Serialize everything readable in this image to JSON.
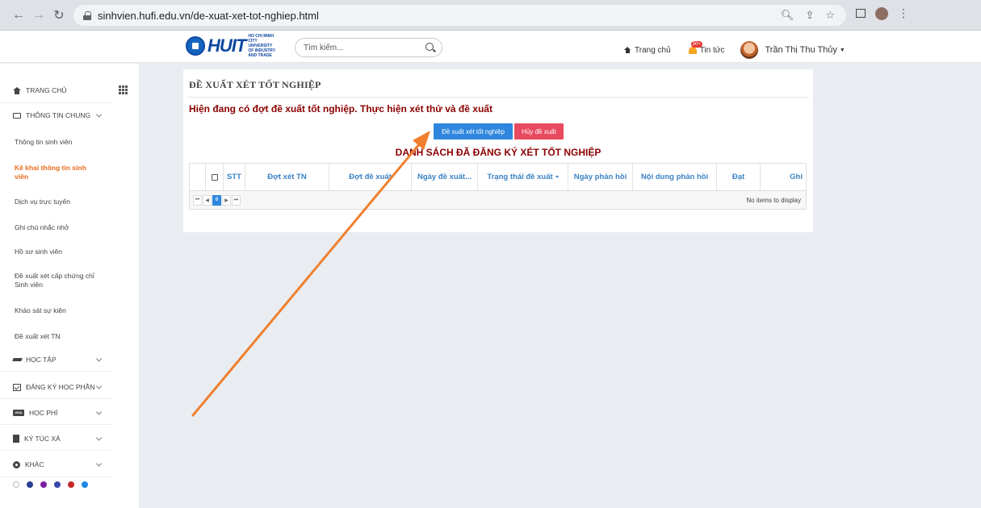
{
  "browser": {
    "url": "sinhvien.hufi.edu.vn/de-xuat-xet-tot-nghiep.html"
  },
  "header": {
    "logo_text": "HUIT",
    "logo_tagline": "HO CHI MINH CITY UNIVERSITY OF INDUSTRY AND TRADE",
    "search_placeholder": "Tìm kiếm...",
    "nav_home": "Trang chủ",
    "nav_news": "Tin tức",
    "news_badge": "30+",
    "user_name": "Trần Thị Thu Thủy"
  },
  "sidebar": {
    "home": "TRANG CHỦ",
    "general": "THÔNG TIN CHUNG",
    "sub": [
      "Thông tin sinh viên",
      "Kê khai thông tin sinh viên",
      "Dịch vụ trực tuyến",
      "Ghi chú nhắc nhở",
      "Hồ sơ sinh viên",
      "Đề xuất xét cấp chứng chỉ Sinh viên",
      "Khảo sát sự kiện",
      "Đề xuất xét TN"
    ],
    "study": "HỌC TẬP",
    "register": "ĐĂNG KÝ HỌC PHẦN",
    "fee": "HỌC PHÍ",
    "dorm": "KÝ TÚC XÁ",
    "other": "KHÁC",
    "visa_text": "VISA",
    "theme_colors": [
      "#ffffff",
      "#2c3e8f",
      "#7b1fa2",
      "#3949ab",
      "#c62828",
      "#1e88e5"
    ]
  },
  "main": {
    "title": "ĐỀ XUẤT XÉT TỐT NGHIỆP",
    "notice": "Hiện đang có đợt đề xuất tốt nghiệp. Thực hiện xét thử và đề xuất",
    "btn_propose": "Đề xuất xét tốt nghiệp",
    "btn_cancel": "Hủy đề xuất",
    "list_title": "DANH SÁCH ĐÃ ĐĂNG KÝ XÉT TỐT NGHIỆP",
    "columns": [
      "STT",
      "Đợt xét TN",
      "Đợt đề xuất",
      "Ngày đề xuất...",
      "Trạng thái đề xuất",
      "Ngày phản hồi",
      "Nội dung phản hồi",
      "Đạt",
      "Ghi"
    ],
    "current_page": "0",
    "empty_text": "No items to display"
  },
  "colors": {
    "accent_blue": "#2e86de",
    "danger": "#e84a5f",
    "notice_red": "#8b0000",
    "active_orange": "#e96a1c",
    "annotation_arrow": "#f07f2e"
  }
}
